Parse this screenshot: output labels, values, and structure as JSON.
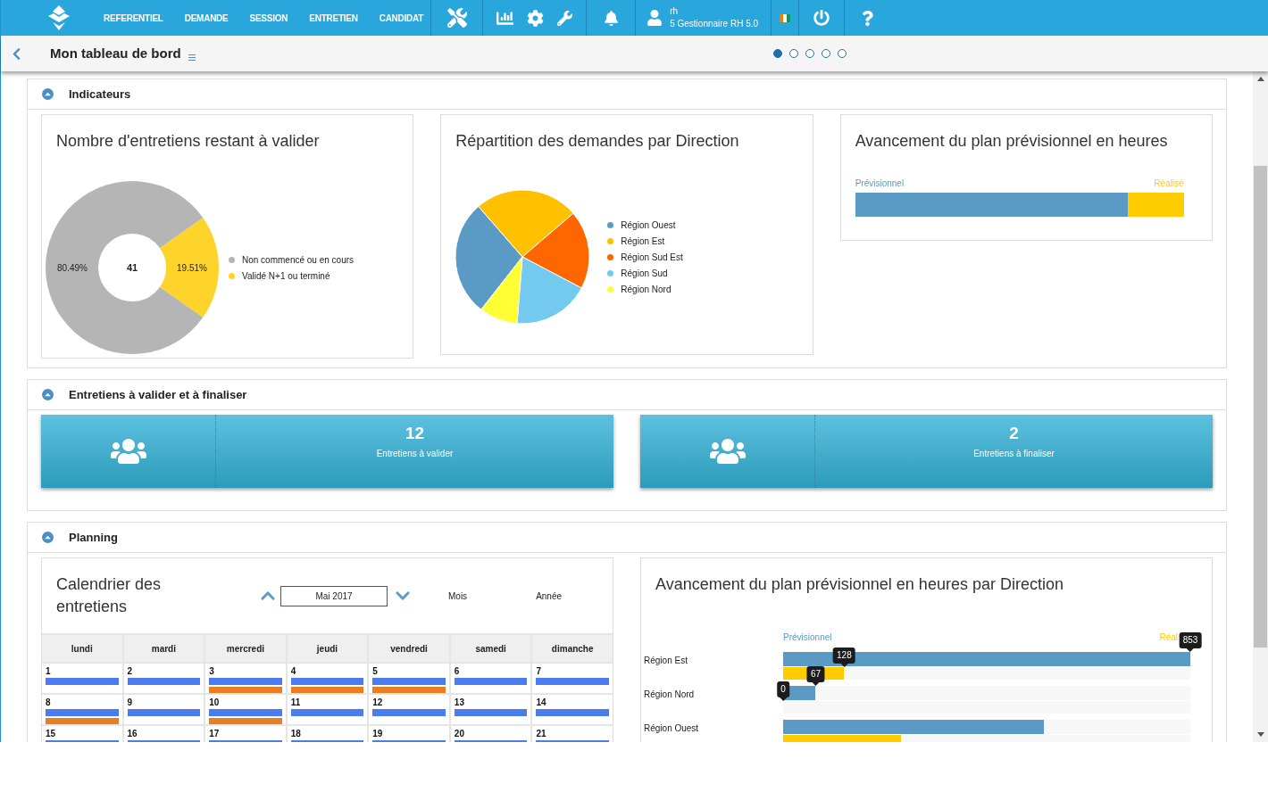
{
  "nav": {
    "menu": [
      {
        "label": "REFERENTIEL"
      },
      {
        "label": "DEMANDE"
      },
      {
        "label": "SESSION"
      },
      {
        "label": "ENTRETIEN"
      },
      {
        "label": "CANDIDAT"
      }
    ],
    "user": {
      "name": "rh",
      "role": "5 Gestionnaire RH 5.0"
    }
  },
  "header": {
    "title": "Mon tableau de bord",
    "pages": [
      {
        "selected": true
      },
      {
        "selected": false
      },
      {
        "selected": false
      },
      {
        "selected": false
      },
      {
        "selected": false
      }
    ]
  },
  "indicators": {
    "title": "Indicateurs",
    "expanded": true,
    "donut_card": {
      "title": "Nombre d'entretiens restant à valider",
      "center_label": "41",
      "slice_styles": [
        {
          "color": "#b5b5b5"
        },
        {
          "color": "#ffd42a"
        }
      ],
      "chart_data": {
        "type": "donut",
        "categories": [
          "Non commencé ou en cours",
          "Validé N+1 ou terminé"
        ],
        "values": [
          80.49,
          19.51
        ],
        "value_labels": [
          "80.49%",
          "19.51%"
        ]
      }
    },
    "pie_card": {
      "title": "Répartition des demandes par Direction",
      "legend": [
        {
          "label": "Région Ouest",
          "color": "#5b9ac4"
        },
        {
          "label": "Région Est",
          "color": "#ffc000"
        },
        {
          "label": "Région Sud Est",
          "color": "#ff6600"
        },
        {
          "label": "Région Sud",
          "color": "#73c9ee"
        },
        {
          "label": "Région Nord",
          "color": "#ffff33"
        }
      ]
    },
    "plan_card": {
      "title": "Avancement du plan prévisionnel en heures",
      "legend_planned": "Prévisionnel",
      "legend_done": "Réalisé",
      "level": 0.83
    }
  },
  "validation": {
    "title": "Entretiens à valider et à finaliser",
    "expanded": true,
    "tiles": [
      {
        "count": "12",
        "label": "Entretiens à valider"
      },
      {
        "count": "2",
        "label": "Entretiens à finaliser"
      }
    ]
  },
  "planning": {
    "title": "Planning",
    "expanded": true,
    "calendar": {
      "title": "Calendrier des entretiens",
      "month": "Mai 2017",
      "views": [
        "Mois",
        "Année"
      ],
      "weekdays": [
        "lundi",
        "mardi",
        "mercredi",
        "jeudi",
        "vendredi",
        "samedi",
        "dimanche"
      ],
      "weeks": [
        [
          {
            "day": "1",
            "events": [
              {
                "color": "#4a7cf0"
              }
            ]
          },
          {
            "day": "2",
            "events": [
              {
                "color": "#4a7cf0"
              }
            ]
          },
          {
            "day": "3",
            "events": [
              {
                "color": "#4a7cf0"
              },
              {
                "color": "#e67e22"
              }
            ]
          },
          {
            "day": "4",
            "events": [
              {
                "color": "#4a7cf0"
              },
              {
                "color": "#e67e22"
              }
            ]
          },
          {
            "day": "5",
            "events": [
              {
                "color": "#4a7cf0"
              },
              {
                "color": "#e67e22"
              }
            ]
          },
          {
            "day": "6",
            "events": [
              {
                "color": "#4a7cf0"
              }
            ]
          },
          {
            "day": "7",
            "events": [
              {
                "color": "#4a7cf0"
              }
            ]
          }
        ],
        [
          {
            "day": "8",
            "events": [
              {
                "color": "#4a7cf0"
              },
              {
                "color": "#e67e22"
              }
            ]
          },
          {
            "day": "9",
            "events": [
              {
                "color": "#4a7cf0"
              }
            ]
          },
          {
            "day": "10",
            "events": [
              {
                "color": "#4a7cf0"
              },
              {
                "color": "#e67e22"
              }
            ]
          },
          {
            "day": "11",
            "events": [
              {
                "color": "#4a7cf0"
              }
            ]
          },
          {
            "day": "12",
            "events": [
              {
                "color": "#4a7cf0"
              }
            ]
          },
          {
            "day": "13",
            "events": [
              {
                "color": "#4a7cf0"
              }
            ]
          },
          {
            "day": "14",
            "events": [
              {
                "color": "#4a7cf0"
              }
            ]
          }
        ],
        [
          {
            "day": "15",
            "events": [
              {
                "color": "#4a7cf0"
              }
            ]
          },
          {
            "day": "16",
            "events": [
              {
                "color": "#4a7cf0"
              }
            ]
          },
          {
            "day": "17",
            "events": [
              {
                "color": "#4a7cf0"
              }
            ]
          },
          {
            "day": "18",
            "events": [
              {
                "color": "#4a7cf0"
              }
            ]
          },
          {
            "day": "19",
            "events": [
              {
                "color": "#4a7cf0"
              }
            ]
          },
          {
            "day": "20",
            "events": [
              {
                "color": "#4a7cf0"
              }
            ]
          },
          {
            "day": "21",
            "events": [
              {
                "color": "#4a7cf0"
              }
            ]
          }
        ]
      ]
    },
    "progress": {
      "title": "Avancement du plan prévisionnel en heures par Direction",
      "legend_planned": "Prévisionnel",
      "legend_done": "Réal",
      "rows": [
        {
          "label": "Région Est",
          "planned": {
            "level": 1,
            "tooltip": "853"
          },
          "done": {
            "level": 0.15,
            "tooltip": "128"
          }
        },
        {
          "label": "Région Nord",
          "planned": {
            "level": 0.08,
            "tooltip": "67"
          },
          "done": {
            "level": 0,
            "tooltip": "0"
          }
        },
        {
          "label": "Région Ouest",
          "planned": {
            "level": 0.64
          },
          "done": {
            "level": 0.29
          }
        }
      ]
    }
  }
}
